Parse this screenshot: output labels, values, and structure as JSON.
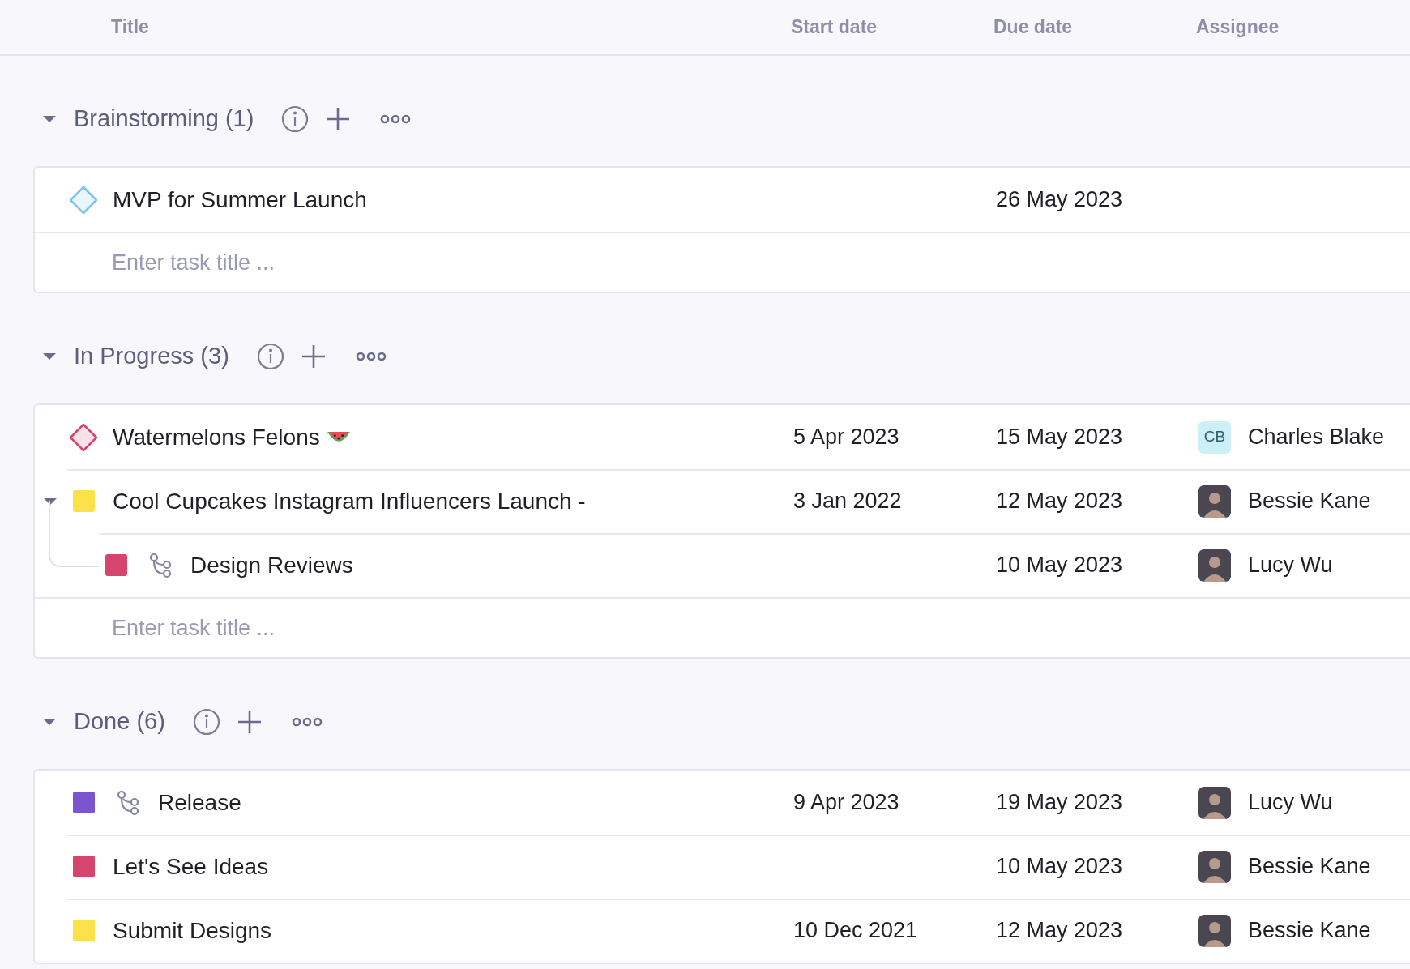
{
  "columns": [
    "Title",
    "Start date",
    "Due date",
    "Assignee"
  ],
  "groups": [
    {
      "title": "Brainstorming (1)",
      "expanded": true,
      "placeholder": "Enter task title ...",
      "tasks": [
        {
          "kind": "milestone",
          "color": "#7cc4ee",
          "title": "MVP for Summer Launch",
          "branch_icon": false,
          "trailing_icon": false,
          "due": "26 May 2023"
        }
      ]
    },
    {
      "title": "In Progress (3)",
      "expanded": true,
      "placeholder": "Enter task title ...",
      "tasks": [
        {
          "kind": "milestone",
          "color": "#d6456e",
          "title": "Watermelons Felons",
          "branch_icon": false,
          "trailing_icon": true,
          "start": "5 Apr 2023",
          "due": "15 May 2023",
          "assignee": {
            "name": "Charles Blake",
            "avatar": {
              "kind": "initials",
              "initials": "CB"
            }
          }
        },
        {
          "kind": "task",
          "color": "#fbe14a",
          "title": "Cool Cupcakes Instagram Influencers Launch -",
          "branch_icon": false,
          "trailing_icon": false,
          "expanded": true,
          "start": "3 Jan 2022",
          "due": "12 May 2023",
          "assignee": {
            "name": "Bessie Kane",
            "avatar": {
              "kind": "photo"
            }
          },
          "children": [
            {
              "kind": "task",
              "color": "#d6456e",
              "title": "Design Reviews",
              "branch_icon": true,
              "trailing_icon": false,
              "due": "10 May 2023",
              "assignee": {
                "name": "Lucy Wu",
                "avatar": {
                  "kind": "photo"
                }
              }
            }
          ]
        }
      ]
    },
    {
      "title": "Done (6)",
      "expanded": true,
      "tasks": [
        {
          "kind": "task",
          "color": "#7b55d0",
          "title": "Release",
          "branch_icon": true,
          "trailing_icon": false,
          "start": "9 Apr 2023",
          "due": "19 May 2023",
          "assignee": {
            "name": "Lucy Wu",
            "avatar": {
              "kind": "photo"
            }
          }
        },
        {
          "kind": "task",
          "color": "#d6456e",
          "title": "Let's See Ideas",
          "branch_icon": false,
          "trailing_icon": false,
          "due": "10 May 2023",
          "assignee": {
            "name": "Bessie Kane",
            "avatar": {
              "kind": "photo"
            }
          }
        },
        {
          "kind": "task",
          "color": "#fbe14a",
          "title": "Submit Designs",
          "branch_icon": false,
          "trailing_icon": false,
          "start": "10 Dec 2021",
          "due": "12 May 2023",
          "assignee": {
            "name": "Bessie Kane",
            "avatar": {
              "kind": "photo"
            }
          }
        }
      ]
    }
  ]
}
